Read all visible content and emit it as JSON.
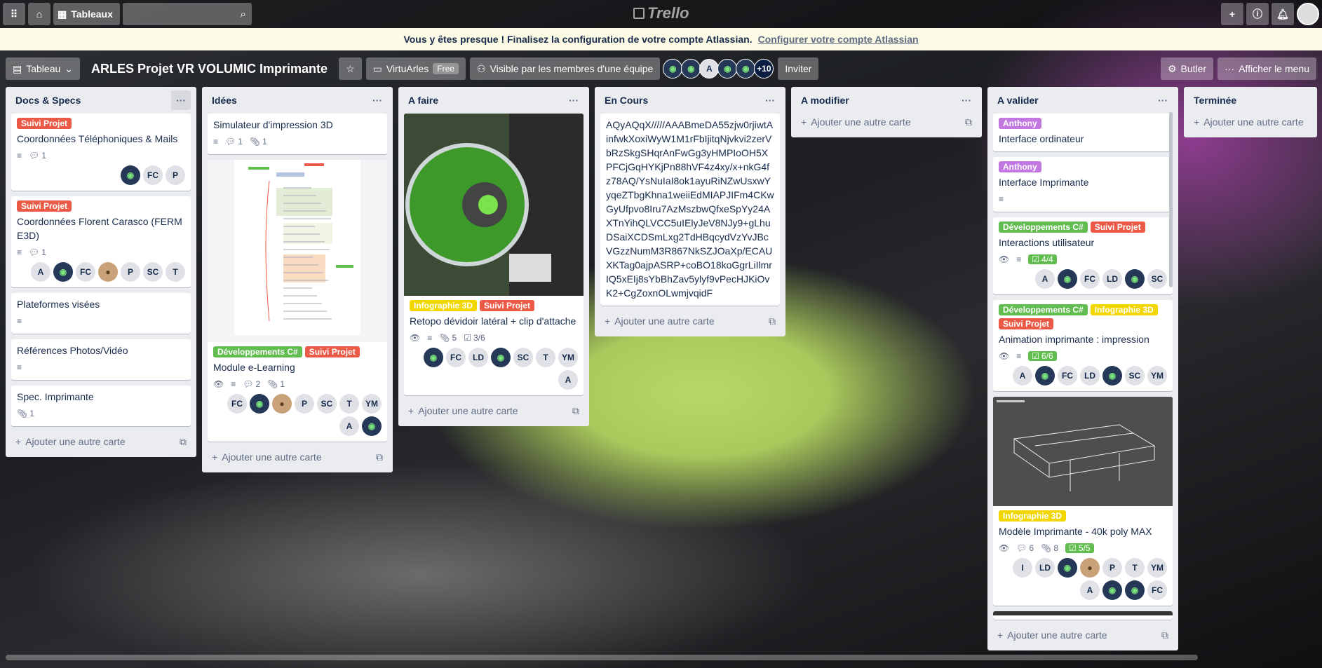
{
  "topbar": {
    "boards_label": "Tableaux",
    "logo_text": "Trello",
    "icons": [
      "apps-icon",
      "home-icon",
      "search-icon",
      "plus-icon",
      "info-icon",
      "bell-icon"
    ]
  },
  "banner": {
    "text": "Vous y êtes presque ! Finalisez la configuration de votre compte Atlassian.",
    "link": "Configurer votre compte Atlassian"
  },
  "board": {
    "view_label": "Tableau",
    "title": "ARLES Projet VR VOLUMIC Imprimante",
    "workspace": "VirtuArles",
    "plan": "Free",
    "visibility": "Visible par les membres d'une équipe",
    "member_initial": "A",
    "more_members": "+10",
    "invite": "Inviter",
    "butler": "Butler",
    "menu": "Afficher le menu"
  },
  "add_card": "Ajouter une autre carte",
  "lists": [
    {
      "title": "Docs & Specs",
      "cards": [
        {
          "labels": [
            {
              "t": "Suivi Projet",
              "c": "red"
            }
          ],
          "title": "Coordonnées Téléphoniques & Mails",
          "desc": true,
          "comments": "1",
          "members": [
            "img",
            "FC",
            "P"
          ]
        },
        {
          "labels": [
            {
              "t": "Suivi Projet",
              "c": "red"
            }
          ],
          "title": "Coordonnées Florent Carasco (FERME3D)",
          "desc": true,
          "comments": "1",
          "members": [
            "A",
            "img",
            "FC",
            "photo",
            "P",
            "SC",
            "T"
          ]
        },
        {
          "title": "Plateformes visées",
          "desc": true
        },
        {
          "title": "Références Photos/Vidéo",
          "desc": true
        },
        {
          "title": "Spec. Imprimante",
          "attach": "1"
        }
      ]
    },
    {
      "title": "Idées",
      "cards": [
        {
          "title": "Simulateur d'impression 3D",
          "desc": true,
          "comments": "1",
          "attach": "1"
        },
        {
          "cover": "mind",
          "labels": [
            {
              "t": "Développements C#",
              "c": "green"
            },
            {
              "t": "Suivi Projet",
              "c": "red"
            }
          ],
          "title": "Module e-Learning",
          "watch": true,
          "desc": true,
          "comments": "2",
          "attach": "1",
          "members": [
            "FC",
            "img",
            "photo",
            "P",
            "SC",
            "T",
            "YM",
            "A",
            "img"
          ]
        }
      ]
    },
    {
      "title": "A faire",
      "cards": [
        {
          "cover": "spool",
          "labels": [
            {
              "t": "Infographie 3D",
              "c": "yellow"
            },
            {
              "t": "Suivi Projet",
              "c": "red"
            }
          ],
          "title": "Retopo dévidoir latéral + clip d'attache",
          "watch": true,
          "desc": true,
          "attach": "5",
          "checklist_plain": "3/6",
          "members": [
            "img",
            "FC",
            "LD",
            "img",
            "SC",
            "T",
            "YM",
            "A"
          ]
        }
      ]
    },
    {
      "title": "En Cours",
      "cards": [
        {
          "title": "AQyAQqX/////AAABmeDA55zjw0rjiwtAinfwkXoxiWyW1M1rFbIjitqNjvkvi2zerVbRzSkgSHqrAnFwGg3yHMPIoOH5XPFCjGqHYKjPn88hVF4z4xy/x+nkG4fz78AQ/YsNuIaI8ok1ayuRiNZwUsxwYyqeZTbgKhna1weiiEdMIAPJIFm4CKwGyUfpvo8Iru7AzMszbwQfxeSpYy24AXTnYihQLVCC5uIElyJeV8NJy9+gLhuDSaiXCDSmLxg2TdHBqcydVzYvJBcVGzzNumM3R867NkSZJOaXp/ECAUXKTag0ajpASRP+coBO18koGgrLiIlmrIQ5xEIj8sYbBhZav5ylyf9vPecHJKiOvK2+CgZoxnOLwmjvqidF"
        }
      ]
    },
    {
      "title": "A modifier",
      "cards": []
    },
    {
      "title": "A valider",
      "cards": [
        {
          "labels": [
            {
              "t": "Anthony",
              "c": "purple"
            }
          ],
          "title": "Interface ordinateur"
        },
        {
          "labels": [
            {
              "t": "Anthony",
              "c": "purple"
            }
          ],
          "title": "Interface Imprimante",
          "desc": true
        },
        {
          "labels": [
            {
              "t": "Développements C#",
              "c": "green"
            },
            {
              "t": "Suivi Projet",
              "c": "red"
            }
          ],
          "title": "Interactions utilisateur",
          "watch": true,
          "desc": true,
          "checklist": "4/4",
          "members": [
            "A",
            "img",
            "FC",
            "LD",
            "img",
            "SC"
          ]
        },
        {
          "labels": [
            {
              "t": "Développements C#",
              "c": "green"
            },
            {
              "t": "Infographie 3D",
              "c": "yellow"
            },
            {
              "t": "Suivi Projet",
              "c": "red"
            }
          ],
          "title": "Animation imprimante : impression",
          "watch": true,
          "desc": true,
          "checklist": "6/6",
          "members": [
            "A",
            "img",
            "FC",
            "LD",
            "img",
            "SC",
            "YM"
          ]
        },
        {
          "cover": "print",
          "labels": [
            {
              "t": "Infographie 3D",
              "c": "yellow"
            }
          ],
          "title": "Modèle Imprimante - 40k poly MAX",
          "watch": true,
          "comments": "6",
          "attach": "8",
          "checklist": "5/5",
          "members": [
            "I",
            "LD",
            "img",
            "photo",
            "P",
            "T",
            "YM",
            "A",
            "img",
            "img",
            "FC"
          ]
        },
        {
          "cover": "dark"
        }
      ]
    },
    {
      "title": "Terminée",
      "cards": []
    }
  ],
  "colors": {
    "red": "#eb5a46",
    "green": "#61bd4f",
    "yellow": "#f2d600",
    "purple": "#c377e0"
  }
}
